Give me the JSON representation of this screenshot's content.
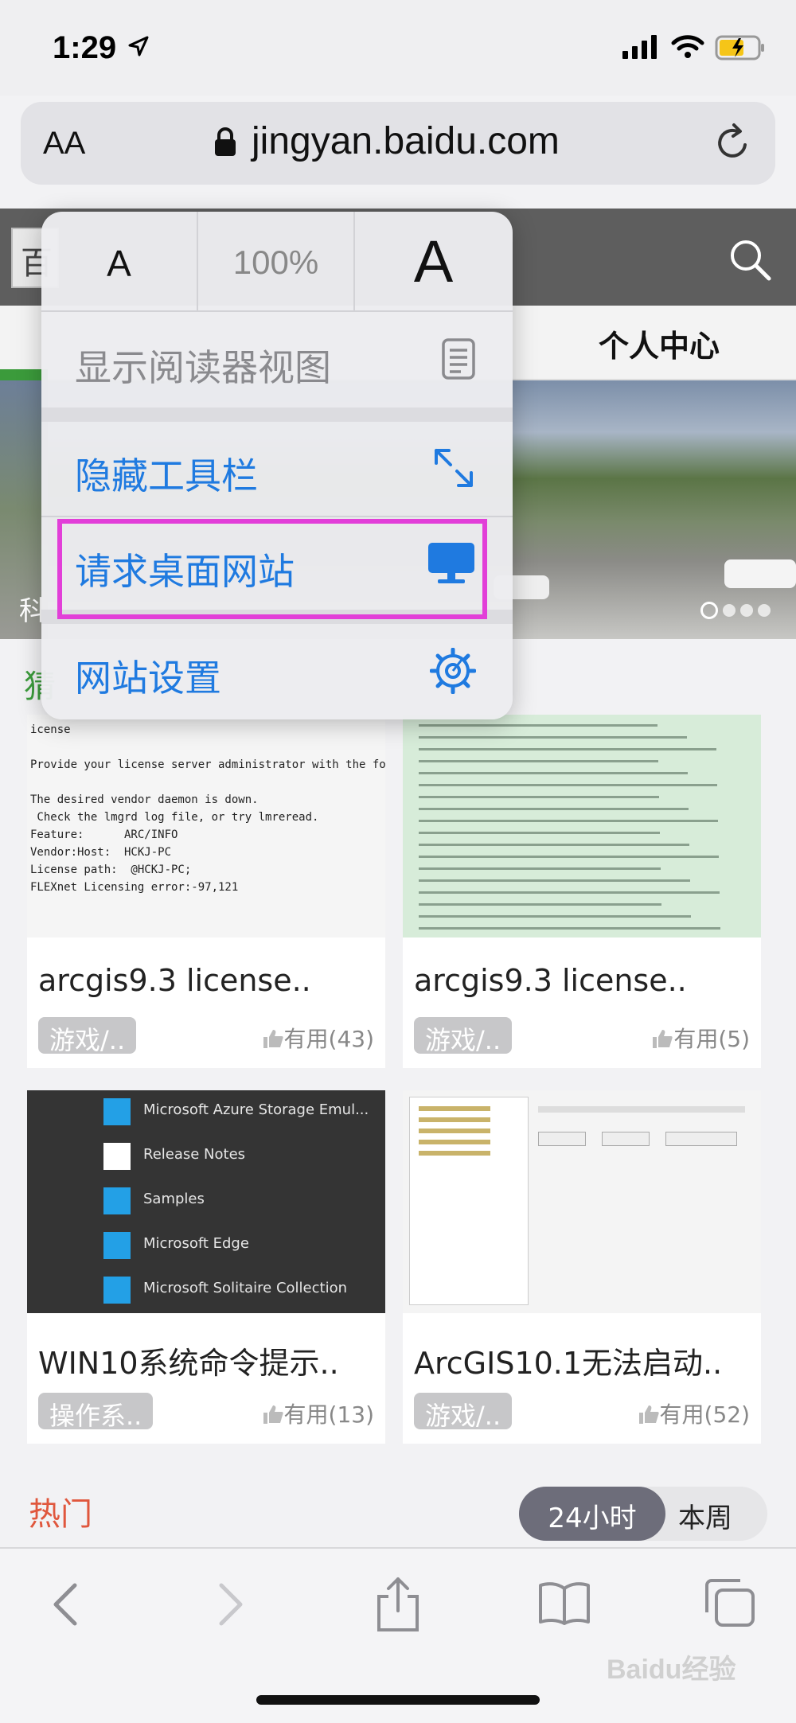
{
  "status_bar": {
    "time": "1:29"
  },
  "url_bar": {
    "aa_label": "AA",
    "url": "jingyan.baidu.com"
  },
  "page": {
    "header_box_char": "百",
    "nav_tab_personal": "个人中心",
    "banner_char": "科",
    "section_char": "猜",
    "cards": [
      {
        "title": "arcgis9.3 license..",
        "tag": "游戏/..",
        "useful": "有用(43)"
      },
      {
        "title": "arcgis9.3 license..",
        "tag": "游戏/..",
        "useful": "有用(5)"
      },
      {
        "title": "WIN10系统命令提示..",
        "tag": "操作系..",
        "useful": "有用(13)"
      },
      {
        "title": "ArcGIS10.1无法启动..",
        "tag": "游戏/..",
        "useful": "有用(52)"
      }
    ],
    "thumb1_lines": [
      "icense",
      "",
      "Provide your license server administrator with the following information:",
      "",
      "The desired vendor daemon is down.",
      " Check the lmgrd log file, or try lmreread.",
      "Feature:      ARC/INFO",
      "Vendor:Host:  HCKJ-PC",
      "License path:  @HCKJ-PC;",
      "FLEXnet Licensing error:-97,121"
    ],
    "thumb3_items": [
      "Microsoft Azure Storage Emul...",
      "Release Notes",
      "Samples",
      "Microsoft Edge",
      "Microsoft Solitaire Collection"
    ],
    "hot_label": "热门",
    "segment": {
      "option_24h": "24小时",
      "option_week": "本周"
    },
    "watermark": "Baidu经验"
  },
  "popup": {
    "zoom_small": "A",
    "zoom_level": "100%",
    "zoom_large": "A",
    "items": {
      "reader_view": "显示阅读器视图",
      "hide_toolbar": "隐藏工具栏",
      "request_desktop": "请求桌面网站",
      "website_settings": "网站设置"
    }
  },
  "colors": {
    "menu_blue": "#1f7ae0",
    "highlight": "#e23fd8",
    "hot_red": "#e0573d",
    "accent_green": "#3b9b3b"
  }
}
